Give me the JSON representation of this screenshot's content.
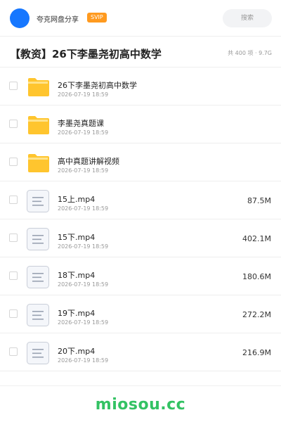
{
  "header": {
    "site_name": "夸克网盘分享",
    "vip_badge": "SVIP",
    "search_placeholder": "搜索"
  },
  "share": {
    "title": "【教资】26下李墨尧初高中数学",
    "meta": "共 400 项 · 9.7G"
  },
  "files": [
    {
      "name": "26下李墨尧初高中数学",
      "date": "2026-07-19 18:59",
      "size": "",
      "type": "folder-icon"
    },
    {
      "name": "李墨尧真题课",
      "date": "2026-07-19 18:59",
      "size": "",
      "type": "folder-icon"
    },
    {
      "name": "高中真题讲解视频",
      "date": "2026-07-19 18:59",
      "size": "",
      "type": "folder-icon"
    },
    {
      "name": "15上.mp4",
      "date": "2026-07-19 18:59",
      "size": "87.5M",
      "type": "file-icon"
    },
    {
      "name": "15下.mp4",
      "date": "2026-07-19 18:59",
      "size": "402.1M",
      "type": "file-icon"
    },
    {
      "name": "18下.mp4",
      "date": "2026-07-19 18:59",
      "size": "180.6M",
      "type": "file-icon"
    },
    {
      "name": "19下.mp4",
      "date": "2026-07-19 18:59",
      "size": "272.2M",
      "type": "file-icon"
    },
    {
      "name": "20下.mp4",
      "date": "2026-07-19 18:59",
      "size": "216.9M",
      "type": "file-icon"
    }
  ],
  "footer": {
    "watermark": "miosou.cc"
  },
  "colors": {
    "accent": "#1677ff",
    "vip": "#ff9a1f",
    "folder": "#ffc52e",
    "watermark": "#33c263"
  }
}
